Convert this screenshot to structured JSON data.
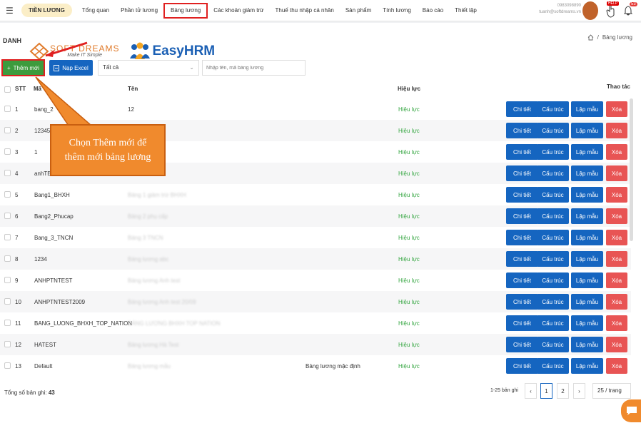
{
  "topbar": {
    "module": "TIỀN LƯƠNG",
    "nav": [
      "Tổng quan",
      "Phần tử lương",
      "Bảng lương",
      "Các khoản giảm trừ",
      "Thuế thu nhập cá nhân",
      "Sản phẩm",
      "Tính lương",
      "Báo cáo",
      "Thiết lập"
    ],
    "active_nav": "Bảng lương",
    "user_line1": "0983098890",
    "user_line2": "tuanh@softdreams.vn",
    "help_badge": "HELP",
    "notif_count": "53"
  },
  "page": {
    "title": "DANH",
    "breadcrumb_current": "Bảng lương"
  },
  "branding": {
    "softdreams": "SOFT DREAMS",
    "softdreams_tagline": "Make IT Simple",
    "easyhrm": "EasyHRM"
  },
  "toolbar": {
    "add_label": "Thêm mới",
    "excel_label": "Nạp Excel",
    "filter_value": "Tất cả",
    "search_placeholder": "Nhập tên, mã bảng lương"
  },
  "table": {
    "headers": {
      "stt": "STT",
      "ma": "Mã",
      "ten": "Tên",
      "hieuluc": "Hiệu lực",
      "thaotac": "Thao tác"
    },
    "actions": {
      "detail": "Chi tiết",
      "structure": "Cấu trúc",
      "template": "Lập mẫu",
      "delete": "Xóa"
    },
    "rows": [
      {
        "stt": "1",
        "ma": "bang_2",
        "ten": "12",
        "note": "",
        "status": "Hiệu lực"
      },
      {
        "stt": "2",
        "ma": "12345",
        "ten": "",
        "note": "",
        "status": "Hiệu lực"
      },
      {
        "stt": "3",
        "ma": "1",
        "ten": "",
        "note": "",
        "status": "Hiệu lực"
      },
      {
        "stt": "4",
        "ma": "anhTE",
        "ten": "",
        "note": "",
        "status": "Hiệu lực"
      },
      {
        "stt": "5",
        "ma": "Bang1_BHXH",
        "ten": "Bảng 1 giảm trừ BHXH",
        "note": "",
        "status": "Hiệu lực"
      },
      {
        "stt": "6",
        "ma": "Bang2_Phucap",
        "ten": "Bảng 2 phụ cấp",
        "note": "",
        "status": "Hiệu lực"
      },
      {
        "stt": "7",
        "ma": "Bang_3_TNCN",
        "ten": "Bảng 3 TNCN",
        "note": "",
        "status": "Hiệu lực"
      },
      {
        "stt": "8",
        "ma": "1234",
        "ten": "Bảng lương abc",
        "note": "",
        "status": "Hiệu lực"
      },
      {
        "stt": "9",
        "ma": "ANHPTNTEST",
        "ten": "Bảng lương Anh test",
        "note": "",
        "status": "Hiệu lực"
      },
      {
        "stt": "10",
        "ma": "ANHPTNTEST2009",
        "ten": "Bảng lương Anh test 20/09",
        "note": "",
        "status": "Hiệu lực"
      },
      {
        "stt": "11",
        "ma": "BANG_LUONG_BHXH_TOP_NATION",
        "ten": "BẢNG LƯƠNG BHXH TOP NATION",
        "note": "",
        "status": "Hiệu lực"
      },
      {
        "stt": "12",
        "ma": "HATEST",
        "ten": "Bảng lương Hà Test",
        "note": "",
        "status": "Hiệu lực"
      },
      {
        "stt": "13",
        "ma": "Default",
        "ten": "Bảng lương mẫu",
        "note": "Bảng lương mặc định",
        "status": "Hiệu lực"
      }
    ]
  },
  "footer": {
    "total_label": "Tổng số bản ghi:",
    "total_value": "43",
    "range": "1-25 bản ghi",
    "pages": [
      "1",
      "2"
    ],
    "per_page": "25 / trang"
  },
  "callout": {
    "line1": "Chọn Thêm mới để",
    "line2": "thêm mới bảng lương"
  },
  "colors": {
    "primary": "#1565c0",
    "add": "#3d9b3d",
    "delete": "#e85454",
    "status": "#39a845",
    "callout": "#f08a2d",
    "highlight": "#e02020"
  }
}
